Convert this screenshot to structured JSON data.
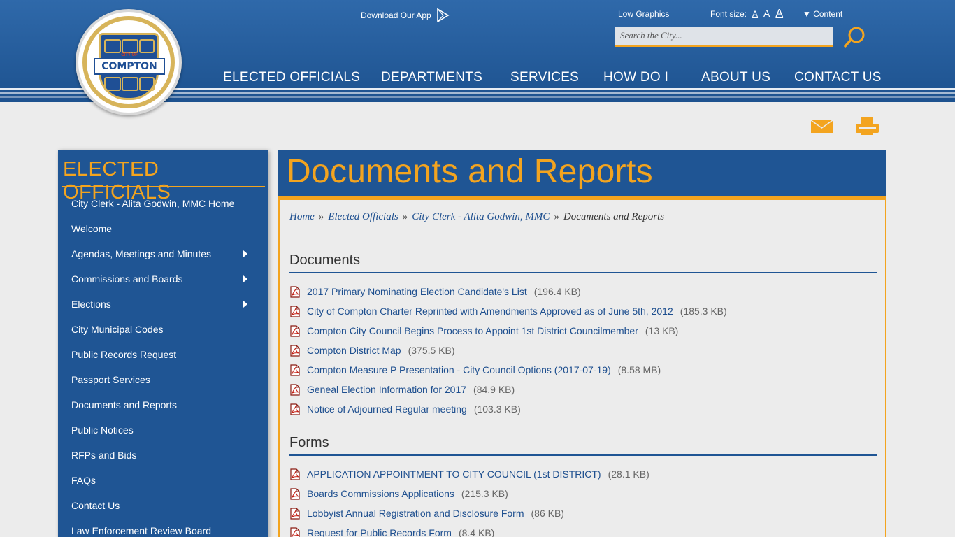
{
  "header": {
    "logo": {
      "city_of": "CITY OF",
      "name": "COMPTON"
    },
    "download_app": "Download Our App",
    "low_graphics": "Low Graphics",
    "font_size_label": "Font size:",
    "font_size_options": [
      "A",
      "A",
      "A"
    ],
    "content_toggle": "▼ Content",
    "search_placeholder": "Search the City...",
    "nav": [
      "ELECTED OFFICIALS",
      "DEPARTMENTS",
      "SERVICES",
      "HOW DO I",
      "ABOUT US",
      "CONTACT US"
    ],
    "colors": {
      "header_blue": "#1d528f",
      "accent": "#f3a41f"
    }
  },
  "tools": {
    "email_icon": "email-icon",
    "print_icon": "print-icon"
  },
  "sidebar": {
    "title": "ELECTED OFFICIALS",
    "items": [
      {
        "label": "City Clerk - Alita Godwin, MMC Home"
      },
      {
        "label": "Welcome"
      },
      {
        "label": "Agendas, Meetings and Minutes"
      },
      {
        "label": "Commissions and Boards"
      },
      {
        "label": "Elections"
      },
      {
        "label": "City Municipal Codes"
      },
      {
        "label": "Public Records Request"
      },
      {
        "label": "Passport Services"
      },
      {
        "label": "Documents and Reports"
      },
      {
        "label": "Public Notices"
      },
      {
        "label": "RFPs and Bids"
      },
      {
        "label": "FAQs"
      },
      {
        "label": "Contact Us"
      },
      {
        "label": "Law Enforcement Review Board"
      }
    ]
  },
  "main": {
    "title": "Documents and Reports",
    "breadcrumb": [
      "Home",
      "Elected Officials",
      "City Clerk - Alita Godwin, MMC",
      "Documents and Reports"
    ],
    "breadcrumb_sep": "»",
    "sections": [
      {
        "heading": "Documents",
        "files": [
          {
            "name": "2017 Primary Nominating Election Candidate's List",
            "size": "(196.4 KB)"
          },
          {
            "name": "City of Compton Charter Reprinted with Amendments Approved as of June 5th, 2012",
            "size": "(185.3 KB)"
          },
          {
            "name": "Compton City Council Begins Process to Appoint 1st District Councilmember",
            "size": "(13 KB)"
          },
          {
            "name": "Compton District Map",
            "size": "(375.5 KB)"
          },
          {
            "name": "Compton Measure P Presentation - City Council Options (2017-07-19)",
            "size": "(8.58 MB)"
          },
          {
            "name": "Geneal Election Information for 2017",
            "size": "(84.9 KB)"
          },
          {
            "name": "Notice of Adjourned Regular meeting",
            "size": "(103.3 KB)"
          }
        ]
      },
      {
        "heading": "Forms",
        "files": [
          {
            "name": "APPLICATION APPOINTMENT TO CITY COUNCIL (1st DISTRICT)",
            "size": "(28.1 KB)"
          },
          {
            "name": "Boards Commissions Applications",
            "size": "(215.3 KB)"
          },
          {
            "name": "Lobbyist Annual Registration and Disclosure Form",
            "size": "(86 KB)"
          },
          {
            "name": "Request for Public Records Form",
            "size": "(8.4 KB)"
          }
        ]
      }
    ]
  }
}
